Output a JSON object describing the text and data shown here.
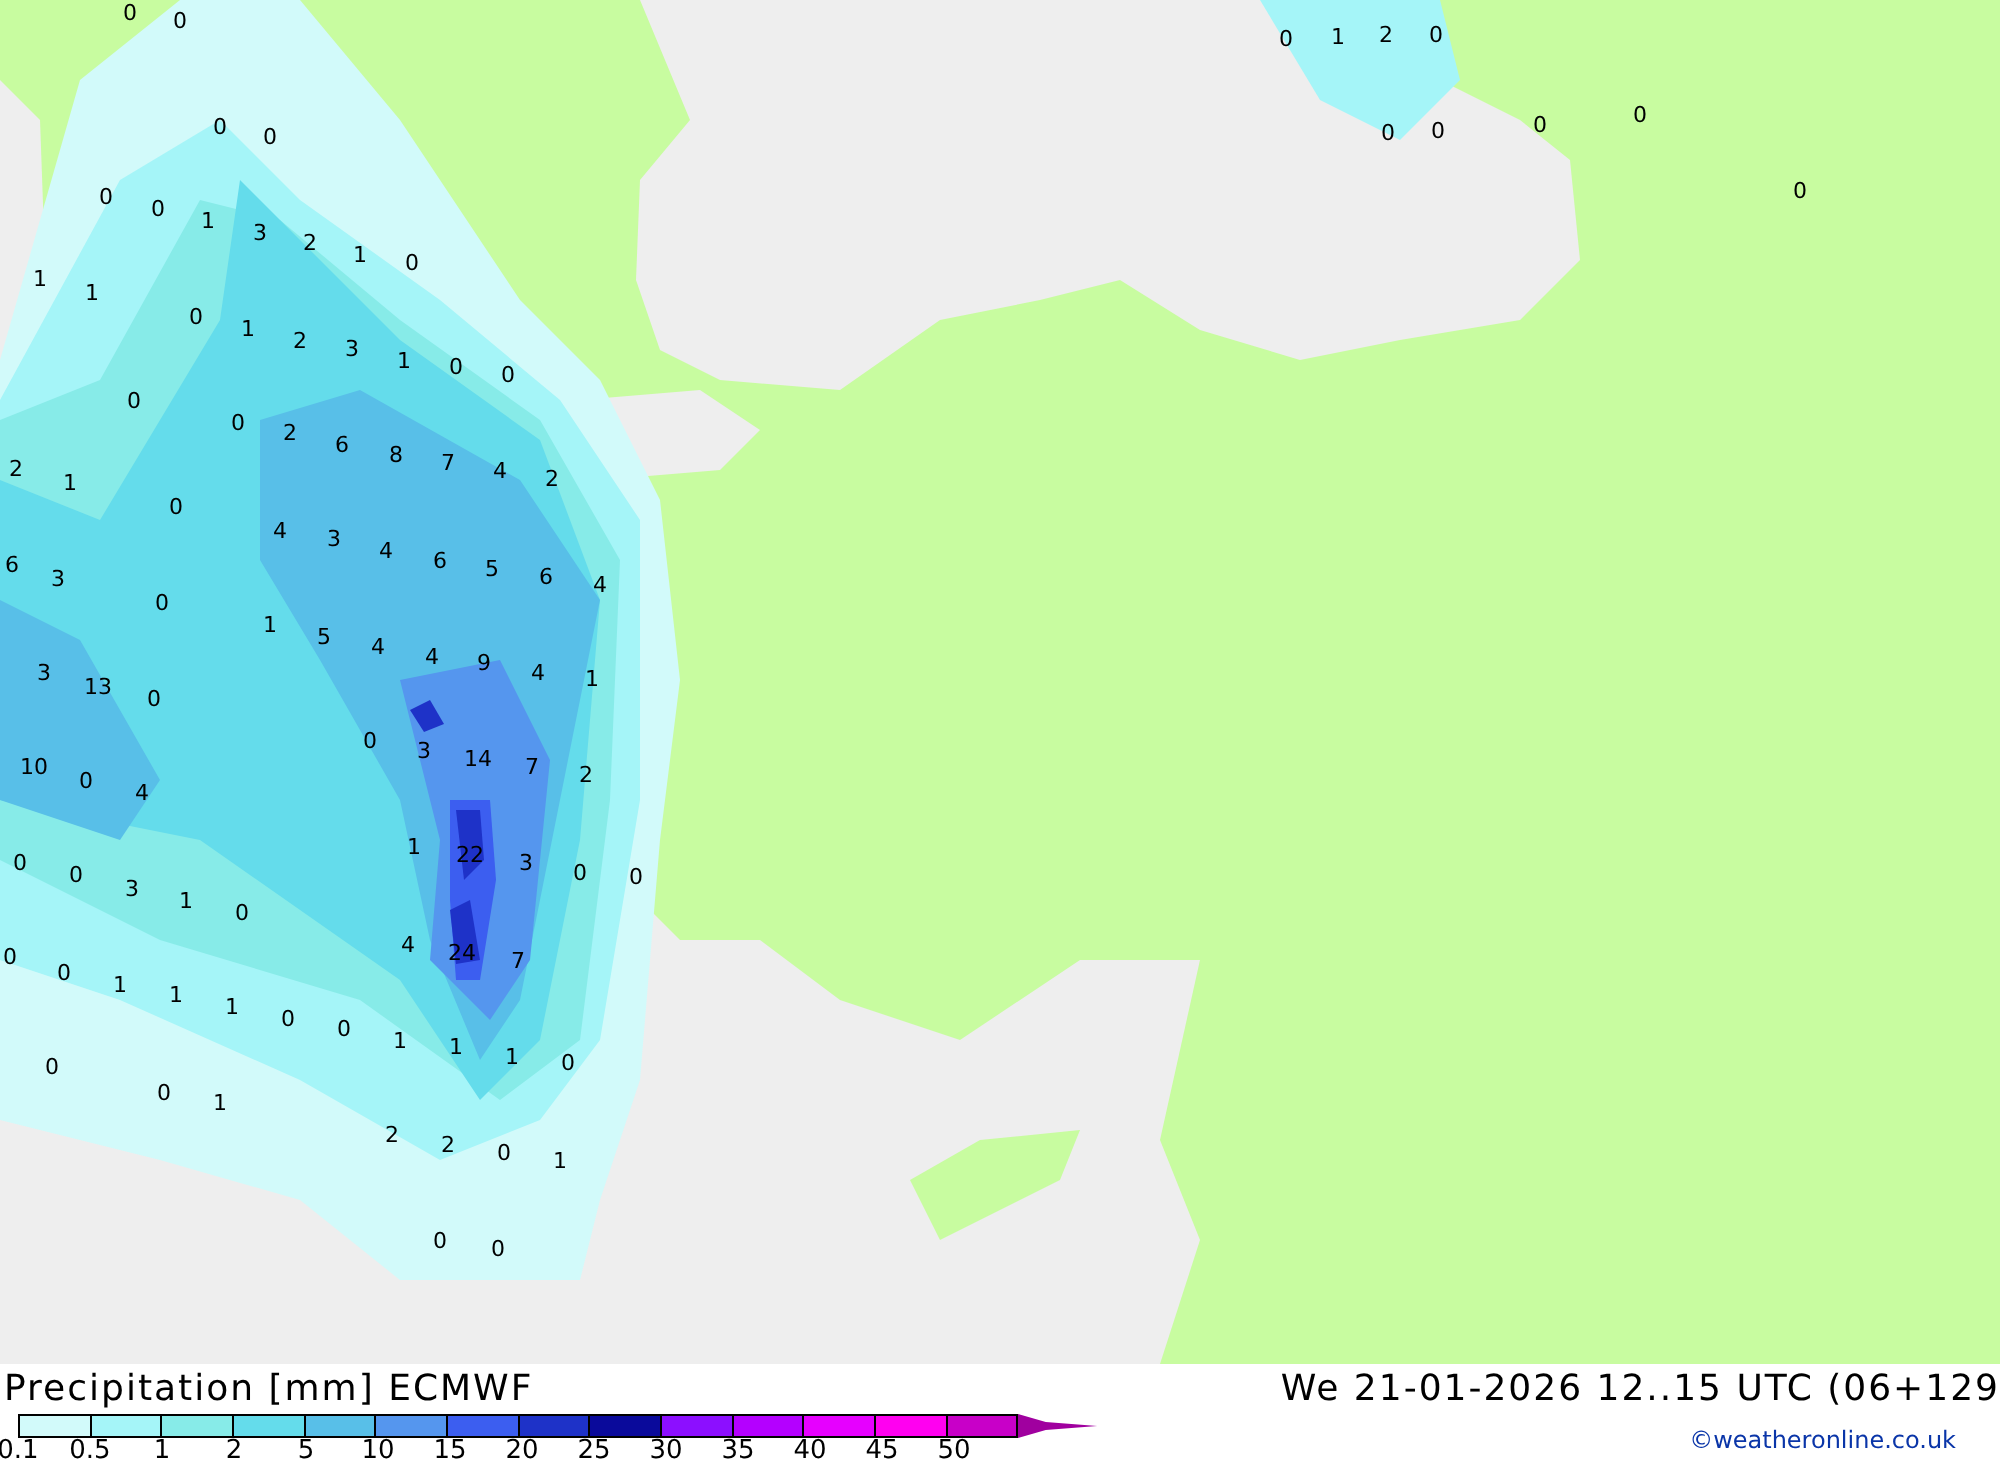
{
  "map": {
    "value_labels": [
      "0",
      "0",
      "0",
      "0",
      "0",
      "0",
      "1",
      "3",
      "2",
      "1",
      "0",
      "1",
      "1",
      "0",
      "1",
      "2",
      "3",
      "1",
      "0",
      "0",
      "0",
      "0",
      "2",
      "6",
      "8",
      "7",
      "4",
      "2",
      "2",
      "1",
      "0",
      "4",
      "3",
      "4",
      "6",
      "5",
      "6",
      "4",
      "6",
      "3",
      "0",
      "1",
      "5",
      "4",
      "4",
      "3",
      "13",
      "0",
      "9",
      "4",
      "1",
      "0",
      "3",
      "14",
      "7",
      "2",
      "10",
      "0",
      "4",
      "1",
      "22",
      "3",
      "0",
      "0",
      "0",
      "0",
      "3",
      "1",
      "0",
      "0",
      "4",
      "24",
      "7",
      "0",
      "1",
      "1",
      "1",
      "0",
      "0",
      "0",
      "1",
      "1",
      "1",
      "0",
      "0",
      "1",
      "2",
      "2",
      "0",
      "1",
      "0",
      "0",
      "0",
      "1",
      "2",
      "0",
      "0",
      "0",
      "0",
      "0",
      "0"
    ]
  },
  "legend": {
    "title": "Precipitation [mm] ECMWF",
    "swatches": [
      {
        "color": "#d2fafa"
      },
      {
        "color": "#a5f5f8"
      },
      {
        "color": "#87ebe8"
      },
      {
        "color": "#64dceb"
      },
      {
        "color": "#58bfe8"
      },
      {
        "color": "#5596ee"
      },
      {
        "color": "#3c5ef0"
      },
      {
        "color": "#1e32c8"
      },
      {
        "color": "#0a0a9b"
      },
      {
        "color": "#8c0fff"
      },
      {
        "color": "#b400ff"
      },
      {
        "color": "#e600ff"
      },
      {
        "color": "#ff00f0"
      },
      {
        "color": "#c800c8"
      }
    ],
    "ticks": [
      "0.1",
      "0.5",
      "1",
      "2",
      "5",
      "10",
      "15",
      "20",
      "25",
      "30",
      "35",
      "40",
      "45",
      "50"
    ]
  },
  "valid_time": "We 21-01-2026 12..15 UTC (06+129",
  "credit": "©weatheronline.co.uk"
}
